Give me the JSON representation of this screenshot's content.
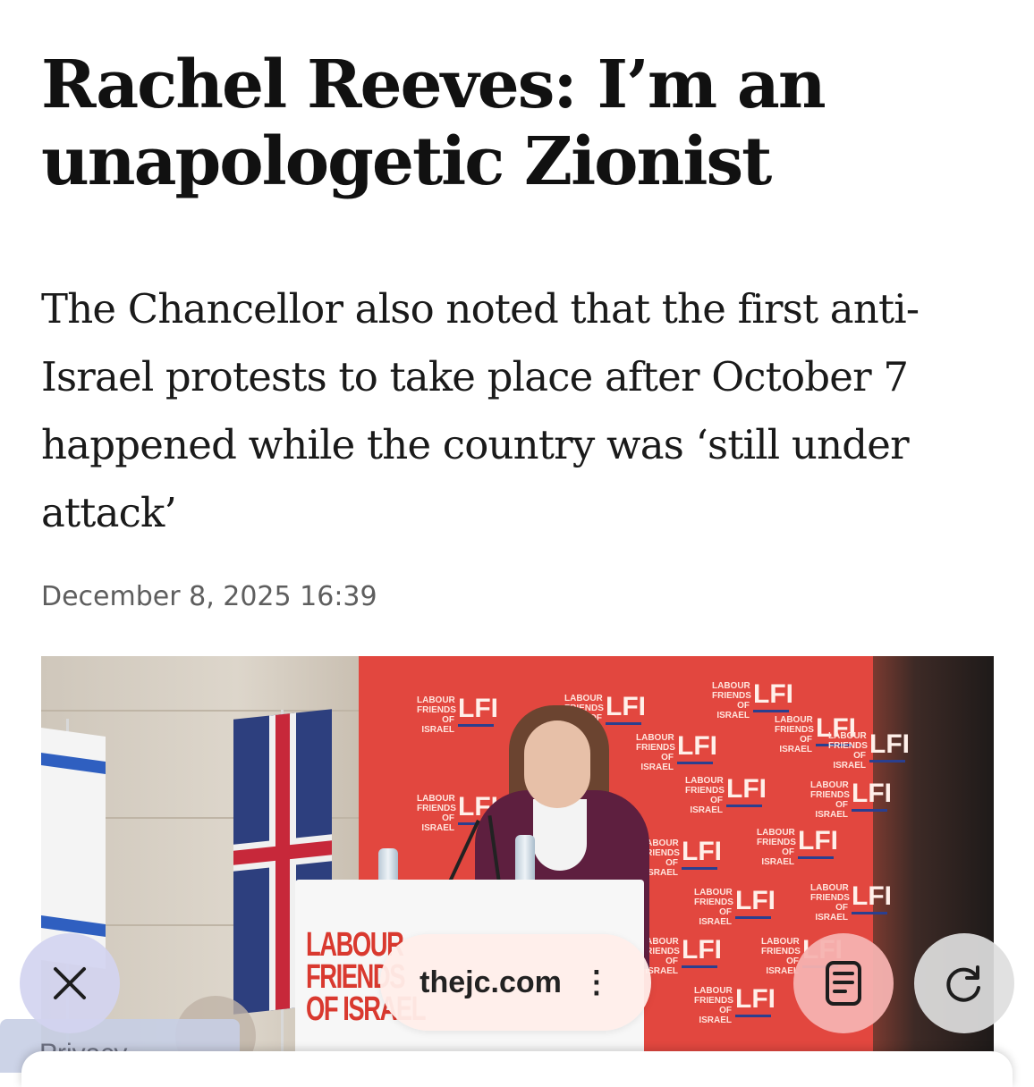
{
  "article": {
    "headline": "Rachel Reeves: I’m an unapologetic Zionist",
    "standfirst": "The Chancellor also noted that the first anti-Israel protests to take place after October 7 happened while the country was ‘still under attack’",
    "date": "December 8, 2025 16:39"
  },
  "photo": {
    "backdrop_logo": {
      "text_lines": "LABOUR FRIENDS OF ISRAEL",
      "mark": "LFI"
    },
    "podium_text": [
      "LABOUR",
      "FRIENDS",
      "OF ISRAEL"
    ]
  },
  "browser": {
    "url": "thejc.com",
    "more_glyph": "⋮",
    "close_icon": "close-icon",
    "reader_icon": "reader-mode-icon",
    "reload_icon": "reload-icon"
  },
  "drawer": {
    "label": "Privacy"
  },
  "colors": {
    "backdrop_red": "#e2473f",
    "reader_button": "#f6b2b0",
    "headline": "#111111"
  }
}
